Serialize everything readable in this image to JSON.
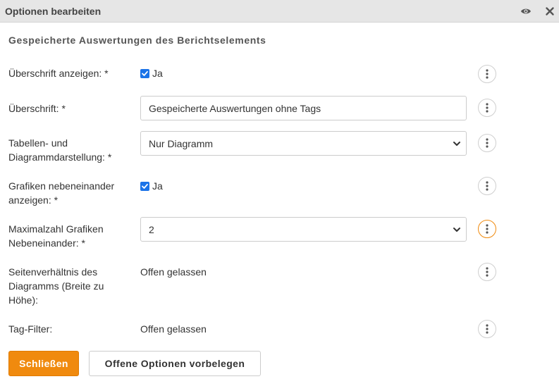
{
  "dialog": {
    "title": "Optionen bearbeiten",
    "icons": {
      "view": "eye-icon",
      "close": "close-icon"
    }
  },
  "section_title": "Gespeicherte Auswertungen des Berichtselements",
  "fields": {
    "show_heading": {
      "label": "Überschrift anzeigen: *",
      "checked": true,
      "checkbox_label": "Ja"
    },
    "heading": {
      "label": "Überschrift: *",
      "value": "Gespeicherte Auswertungen ohne Tags"
    },
    "display_mode": {
      "label_line1": "Tabellen- und",
      "label_line2": "Diagrammdarstellung: *",
      "selected": "Nur Diagramm"
    },
    "side_by_side": {
      "label_line1": "Grafiken nebeneinander",
      "label_line2": "anzeigen: *",
      "checked": true,
      "checkbox_label": "Ja"
    },
    "max_side_by_side": {
      "label_line1": "Maximalzahl Grafiken",
      "label_line2": "Nebeneinander: *",
      "selected": "2"
    },
    "aspect_ratio": {
      "label_line1": "Seitenverhältnis des",
      "label_line2": "Diagramms (Breite zu",
      "label_line3": "Höhe):",
      "value": "Offen gelassen"
    },
    "tag_filter": {
      "label": "Tag-Filter:",
      "value": "Offen gelassen"
    }
  },
  "buttons": {
    "close_label": "Schließen",
    "prefill_label": "Offene Optionen vorbelegen"
  },
  "colors": {
    "accent": "#f08a0e",
    "checkbox": "#1a73e8",
    "titlebar": "#e6e6e6"
  }
}
